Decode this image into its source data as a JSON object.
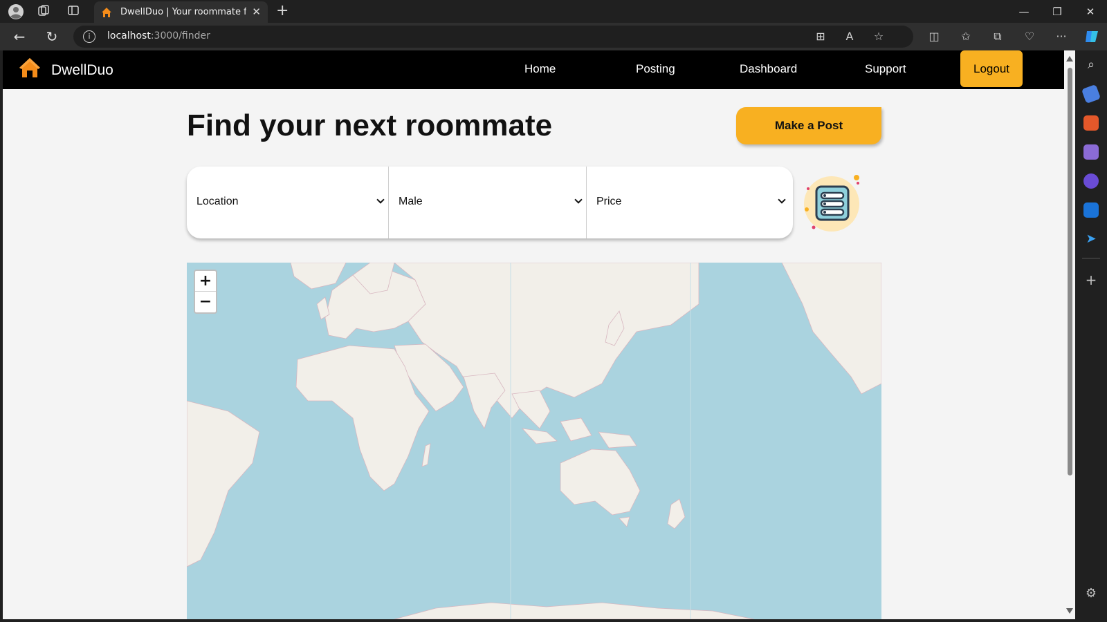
{
  "browser": {
    "tab_title": "DwellDuo | Your roommate finder",
    "url_host": "localhost",
    "url_path": ":3000/finder"
  },
  "site": {
    "brand": "DwellDuo",
    "nav": [
      "Home",
      "Posting",
      "Dashboard",
      "Support"
    ],
    "logout_label": "Logout"
  },
  "main": {
    "title": "Find your next roommate",
    "make_post_label": "Make a Post",
    "filters": [
      {
        "label": "Location"
      },
      {
        "label": "Male"
      },
      {
        "label": "Price"
      }
    ]
  },
  "map": {
    "zoom_in": "+",
    "zoom_out": "−"
  },
  "colors": {
    "accent": "#f8b021",
    "nav_bg": "#000000",
    "ocean": "#aad3df",
    "land": "#f2efe9"
  }
}
